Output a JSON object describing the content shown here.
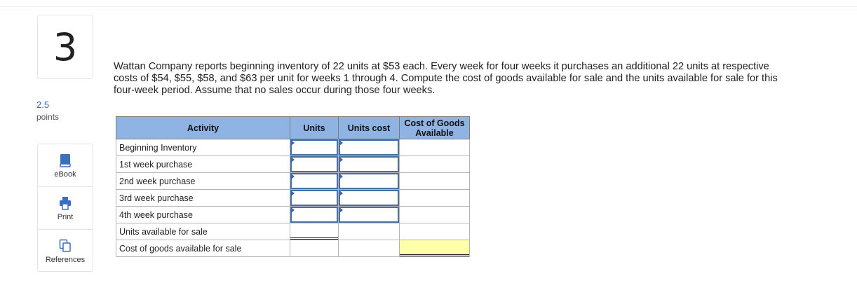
{
  "question": {
    "number": "3",
    "points_value": "2.5",
    "points_label": "points",
    "text": "Wattan Company reports beginning inventory of 22 units at $53 each. Every week for four weeks it purchases an additional 22 units at respective costs of $54, $55, $58, and $63 per unit for weeks 1 through 4. Compute the cost of goods available for sale and the units available for sale for this four-week period. Assume that no sales occur during those four weeks."
  },
  "tools": [
    {
      "label": "eBook",
      "icon": "book-icon"
    },
    {
      "label": "Print",
      "icon": "printer-icon"
    },
    {
      "label": "References",
      "icon": "copy-pages-icon"
    }
  ],
  "table": {
    "headers": [
      "Activity",
      "Units",
      "Units cost",
      "Cost of Goods Available"
    ],
    "rows": [
      {
        "label": "Beginning Inventory"
      },
      {
        "label": "1st week purchase"
      },
      {
        "label": "2nd week purchase"
      },
      {
        "label": "3rd week purchase"
      },
      {
        "label": "4th week purchase"
      },
      {
        "label": "Units available for sale"
      },
      {
        "label": "Cost of goods available for sale"
      }
    ]
  },
  "colors": {
    "header_bg": "#8fb3e3",
    "input_border": "#4a6fa2",
    "highlight_cell": "#ffffa8",
    "points_text": "#2a6bb8"
  }
}
